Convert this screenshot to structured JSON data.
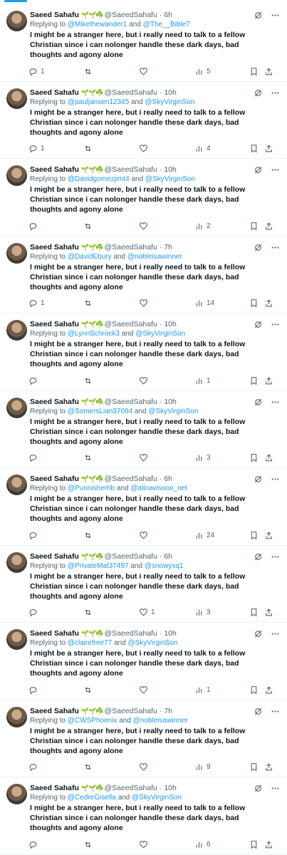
{
  "tweet_text": "I might be a stranger here, but i really need to talk to a fellow Christian since i can nolonger handle these dark days, bad thoughts and agony alone",
  "author": {
    "name": "Saeed Sahafu",
    "emoji": "🌱🌱☘️",
    "handle": "@SaeedSahafu"
  },
  "replying_prefix": "Replying to",
  "and_word": "and",
  "tweets": [
    {
      "time": "6h",
      "replying": true,
      "mention1": "@Mikethewander1",
      "mention2": "@The__Bible7",
      "replies": "1",
      "likes": "",
      "views": "5"
    },
    {
      "time": "10h",
      "replying": true,
      "mention1": "@pauljansen12345",
      "mention2": "@SkyVirginSon",
      "replies": "1",
      "likes": "",
      "views": "4"
    },
    {
      "time": "10h",
      "replying": true,
      "mention1": "@Davidgomezjimt4",
      "mention2": "@SkyVirginSon",
      "replies": "",
      "likes": "",
      "views": "2"
    },
    {
      "time": "7h",
      "replying": true,
      "mention1": "@DavidEbury",
      "mention2": "@nobleisawinner",
      "replies": "1",
      "likes": "",
      "views": "14"
    },
    {
      "time": "10h",
      "replying": true,
      "mention1": "@LynnSchrock3",
      "mention2": "@SkyVirginSon",
      "replies": "",
      "likes": "",
      "views": "1"
    },
    {
      "time": "10h",
      "replying": true,
      "mention1": "@SomersLian37094",
      "mention2": "@SkyVirginSon",
      "replies": "",
      "likes": "",
      "views": "3"
    },
    {
      "time": "6h",
      "replying": true,
      "mention1": "@Punnisherhb",
      "mention2": "@alinavisooo_net",
      "replies": "",
      "likes": "",
      "views": "24"
    },
    {
      "time": "6h",
      "replying": true,
      "mention1": "@PrivateMat37497",
      "mention2": "@snowyxq1",
      "replies": "",
      "likes": "1",
      "views": "3"
    },
    {
      "time": "10h",
      "replying": true,
      "mention1": "@clairefree77",
      "mention2": "@SkyVirginSon",
      "replies": "",
      "likes": "",
      "views": "1"
    },
    {
      "time": "7h",
      "replying": true,
      "mention1": "@CWSPhoenix",
      "mention2": "@nobleisawinner",
      "replies": "",
      "likes": "",
      "views": "9"
    },
    {
      "time": "10h",
      "replying": true,
      "mention1": "@CedreGisella",
      "mention2": "@SkyVirginSon",
      "replies": "",
      "likes": "",
      "views": "6"
    }
  ],
  "colors": {
    "accent": "#1d9bf0",
    "text": "#0f1419",
    "secondary": "#536471",
    "divider": "#eff3f4"
  },
  "icons": [
    "reply-icon",
    "retweet-icon",
    "like-icon",
    "views-icon",
    "bookmark-icon",
    "share-icon",
    "grok-icon",
    "more-icon"
  ]
}
